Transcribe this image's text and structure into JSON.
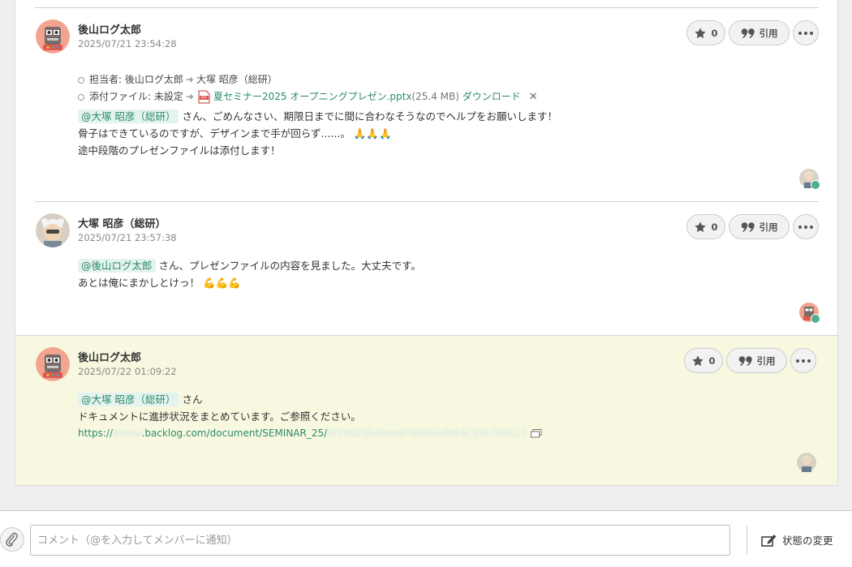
{
  "comments": [
    {
      "author": "後山ログ太郎",
      "date": "2025/07/21 23:54:28",
      "star_count": "0",
      "quote_label": "引用",
      "changes": {
        "assignee_label": "担当者:",
        "assignee_from": "後山ログ太郎",
        "assignee_to": "大塚 昭彦（総研）",
        "attachment_label": "添付ファイル:",
        "attachment_from": "未設定",
        "file_name": "夏セミナー2025 オープニングプレゼン.pptx",
        "file_size": "(25.4 MB)",
        "download_label": "ダウンロード"
      },
      "mention": "@大塚 昭彦（総研）",
      "line1": " さん、ごめんなさい、期限日までに間に合わなそうなのでヘルプをお願いします！",
      "line2": "骨子はできているのですが、デザインまで手が回らず......。",
      "line2_emoji": "🙏🙏🙏",
      "line3": "途中段階のプレゼンファイルは添付します！"
    },
    {
      "author": "大塚 昭彦（総研）",
      "date": "2025/07/21 23:57:38",
      "star_count": "0",
      "quote_label": "引用",
      "mention": "@後山ログ太郎",
      "line1": " さん、プレゼンファイルの内容を見ました。大丈夫です。",
      "line2": "あとは俺にまかしとけっ！",
      "line2_emoji": "💪💪💪"
    },
    {
      "author": "後山ログ太郎",
      "date": "2025/07/22 01:09:22",
      "star_count": "0",
      "quote_label": "引用",
      "mention": "@大塚 昭彦（総研）",
      "line1": " さん",
      "line2": "ドキュメントに進捗状況をまとめています。ご参照ください。",
      "url_prefix": "https://",
      "url_blur1": "xxxxx",
      "url_middle": ".backlog.com/document/SEMINAR_25/",
      "url_blur2": "0f19625b44aa679856edb63c33a704517"
    }
  ],
  "footer": {
    "comment_placeholder": "コメント（@を入力してメンバーに通知）",
    "status_change_label": "状態の変更"
  },
  "colors": {
    "accent_green": "#2a8b6a",
    "highlight_bg": "#f8f8e0",
    "mention_bg": "#e5f3ee"
  }
}
